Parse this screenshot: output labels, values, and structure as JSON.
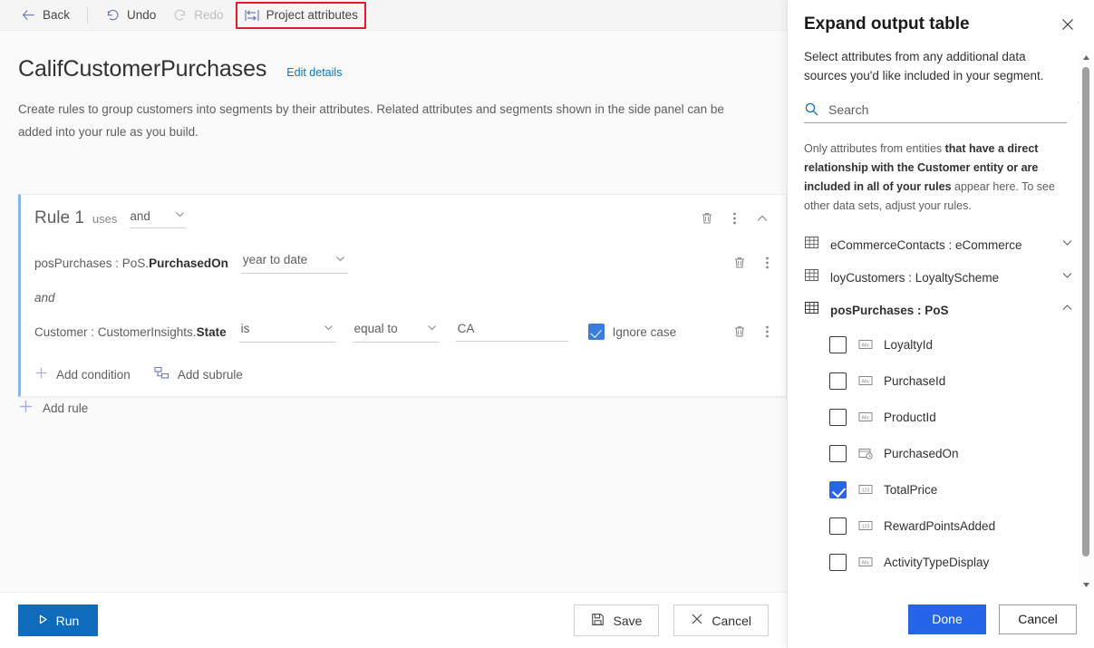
{
  "toolbar": {
    "back": "Back",
    "undo": "Undo",
    "redo": "Redo",
    "project_attributes": "Project attributes",
    "highlight_color": "#e8192c"
  },
  "page": {
    "title": "CalifCustomerPurchases",
    "edit_details": "Edit details",
    "description": "Create rules to group customers into segments by their attributes. Related attributes and segments shown in the side panel can be added into your rule as you build."
  },
  "rule": {
    "name": "Rule 1",
    "uses_label": "uses",
    "operator": "and",
    "conditions": [
      {
        "attribute_prefix": "posPurchases : PoS.",
        "attribute_bold": "PurchasedOn",
        "value": "year to date"
      },
      {
        "attribute_prefix": "Customer : CustomerInsights.",
        "attribute_bold": "State",
        "comparator": "is",
        "operator": "equal to",
        "value": "CA",
        "ignore_case_label": "Ignore case",
        "ignore_case_checked": true
      }
    ],
    "joiner": "and",
    "add_condition": "Add condition",
    "add_subrule": "Add subrule",
    "accent_color": "#86b7e8"
  },
  "add_rule": "Add rule",
  "footer": {
    "run": "Run",
    "save": "Save",
    "cancel": "Cancel",
    "run_color": "#0f6cbd"
  },
  "panel": {
    "title": "Expand output table",
    "subtitle": "Select attributes from any additional data sources you'd like included in your segment.",
    "search_placeholder": "Search",
    "search_value": "",
    "note_part1": "Only attributes from entities ",
    "note_bold1": "that have a direct relationship with the Customer entity or are included in all of your rules",
    "note_part2": " appear here. To see other data sets, adjust your rules.",
    "sources": [
      {
        "name": "eCommerceContacts : eCommerce",
        "expanded": false
      },
      {
        "name": "loyCustomers : LoyaltyScheme",
        "expanded": false
      },
      {
        "name": "posPurchases : PoS",
        "expanded": true
      }
    ],
    "attributes": [
      {
        "name": "LoyaltyId",
        "type": "text",
        "checked": false
      },
      {
        "name": "PurchaseId",
        "type": "text",
        "checked": false
      },
      {
        "name": "ProductId",
        "type": "text",
        "checked": false
      },
      {
        "name": "PurchasedOn",
        "type": "date",
        "checked": false
      },
      {
        "name": "TotalPrice",
        "type": "number",
        "checked": true
      },
      {
        "name": "RewardPointsAdded",
        "type": "number",
        "checked": false
      },
      {
        "name": "ActivityTypeDisplay",
        "type": "text",
        "checked": false
      }
    ],
    "done": "Done",
    "cancel": "Cancel",
    "accent_color": "#2664e8"
  }
}
